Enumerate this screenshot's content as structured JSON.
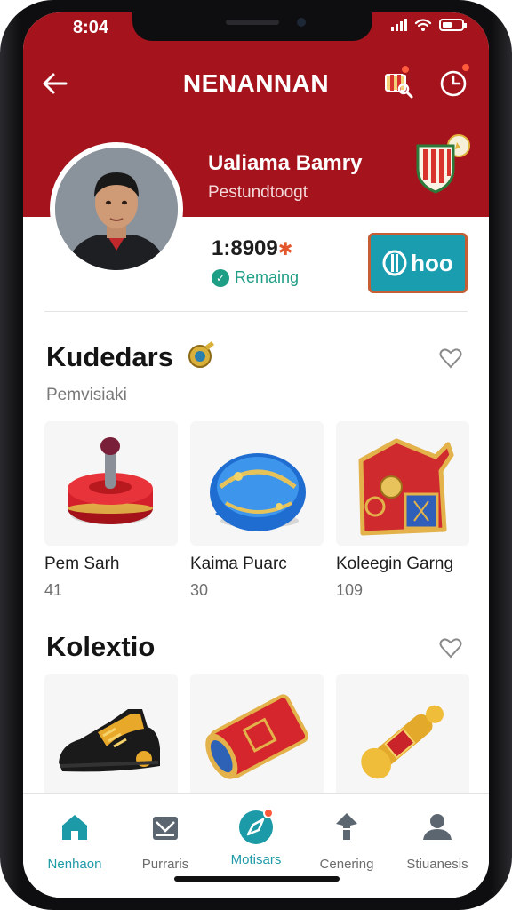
{
  "status_bar": {
    "time": "8:04"
  },
  "header": {
    "title": "NENANNAN"
  },
  "profile": {
    "name": "Ualiama Bamry",
    "subtitle": "Pestundtoogt",
    "points": "1:8909",
    "points_label": "Remaing",
    "cta_label": "hoo"
  },
  "section_featured": {
    "title": "Kudedars",
    "subtitle": "Pemvisiaki",
    "items": [
      {
        "name": "Pem Sarh",
        "count": "41",
        "icon": "spinning-top-icon"
      },
      {
        "name": "Kaima Puarc",
        "count": "30",
        "icon": "blue-orb-icon"
      },
      {
        "name": "Koleegin Garng",
        "count": "109",
        "icon": "treasure-box-icon"
      }
    ]
  },
  "section_collection": {
    "title": "Kolextio",
    "items": [
      {
        "icon": "sneaker-icon"
      },
      {
        "icon": "drum-icon"
      },
      {
        "icon": "gold-scroll-icon"
      }
    ]
  },
  "tabbar": {
    "tabs": [
      {
        "label": "Nenhaon",
        "icon": "home-icon",
        "active": true
      },
      {
        "label": "Purraris",
        "icon": "inbox-icon",
        "active": false
      },
      {
        "label": "Motisars",
        "icon": "compass-icon",
        "active": false
      },
      {
        "label": "Cenering",
        "icon": "pin-icon",
        "active": false
      },
      {
        "label": "Stiuanesis",
        "icon": "user-icon",
        "active": false
      }
    ]
  },
  "colors": {
    "primary_red": "#a5141c",
    "accent_teal": "#1d9aa7",
    "cta_teal": "#1b9db0"
  }
}
